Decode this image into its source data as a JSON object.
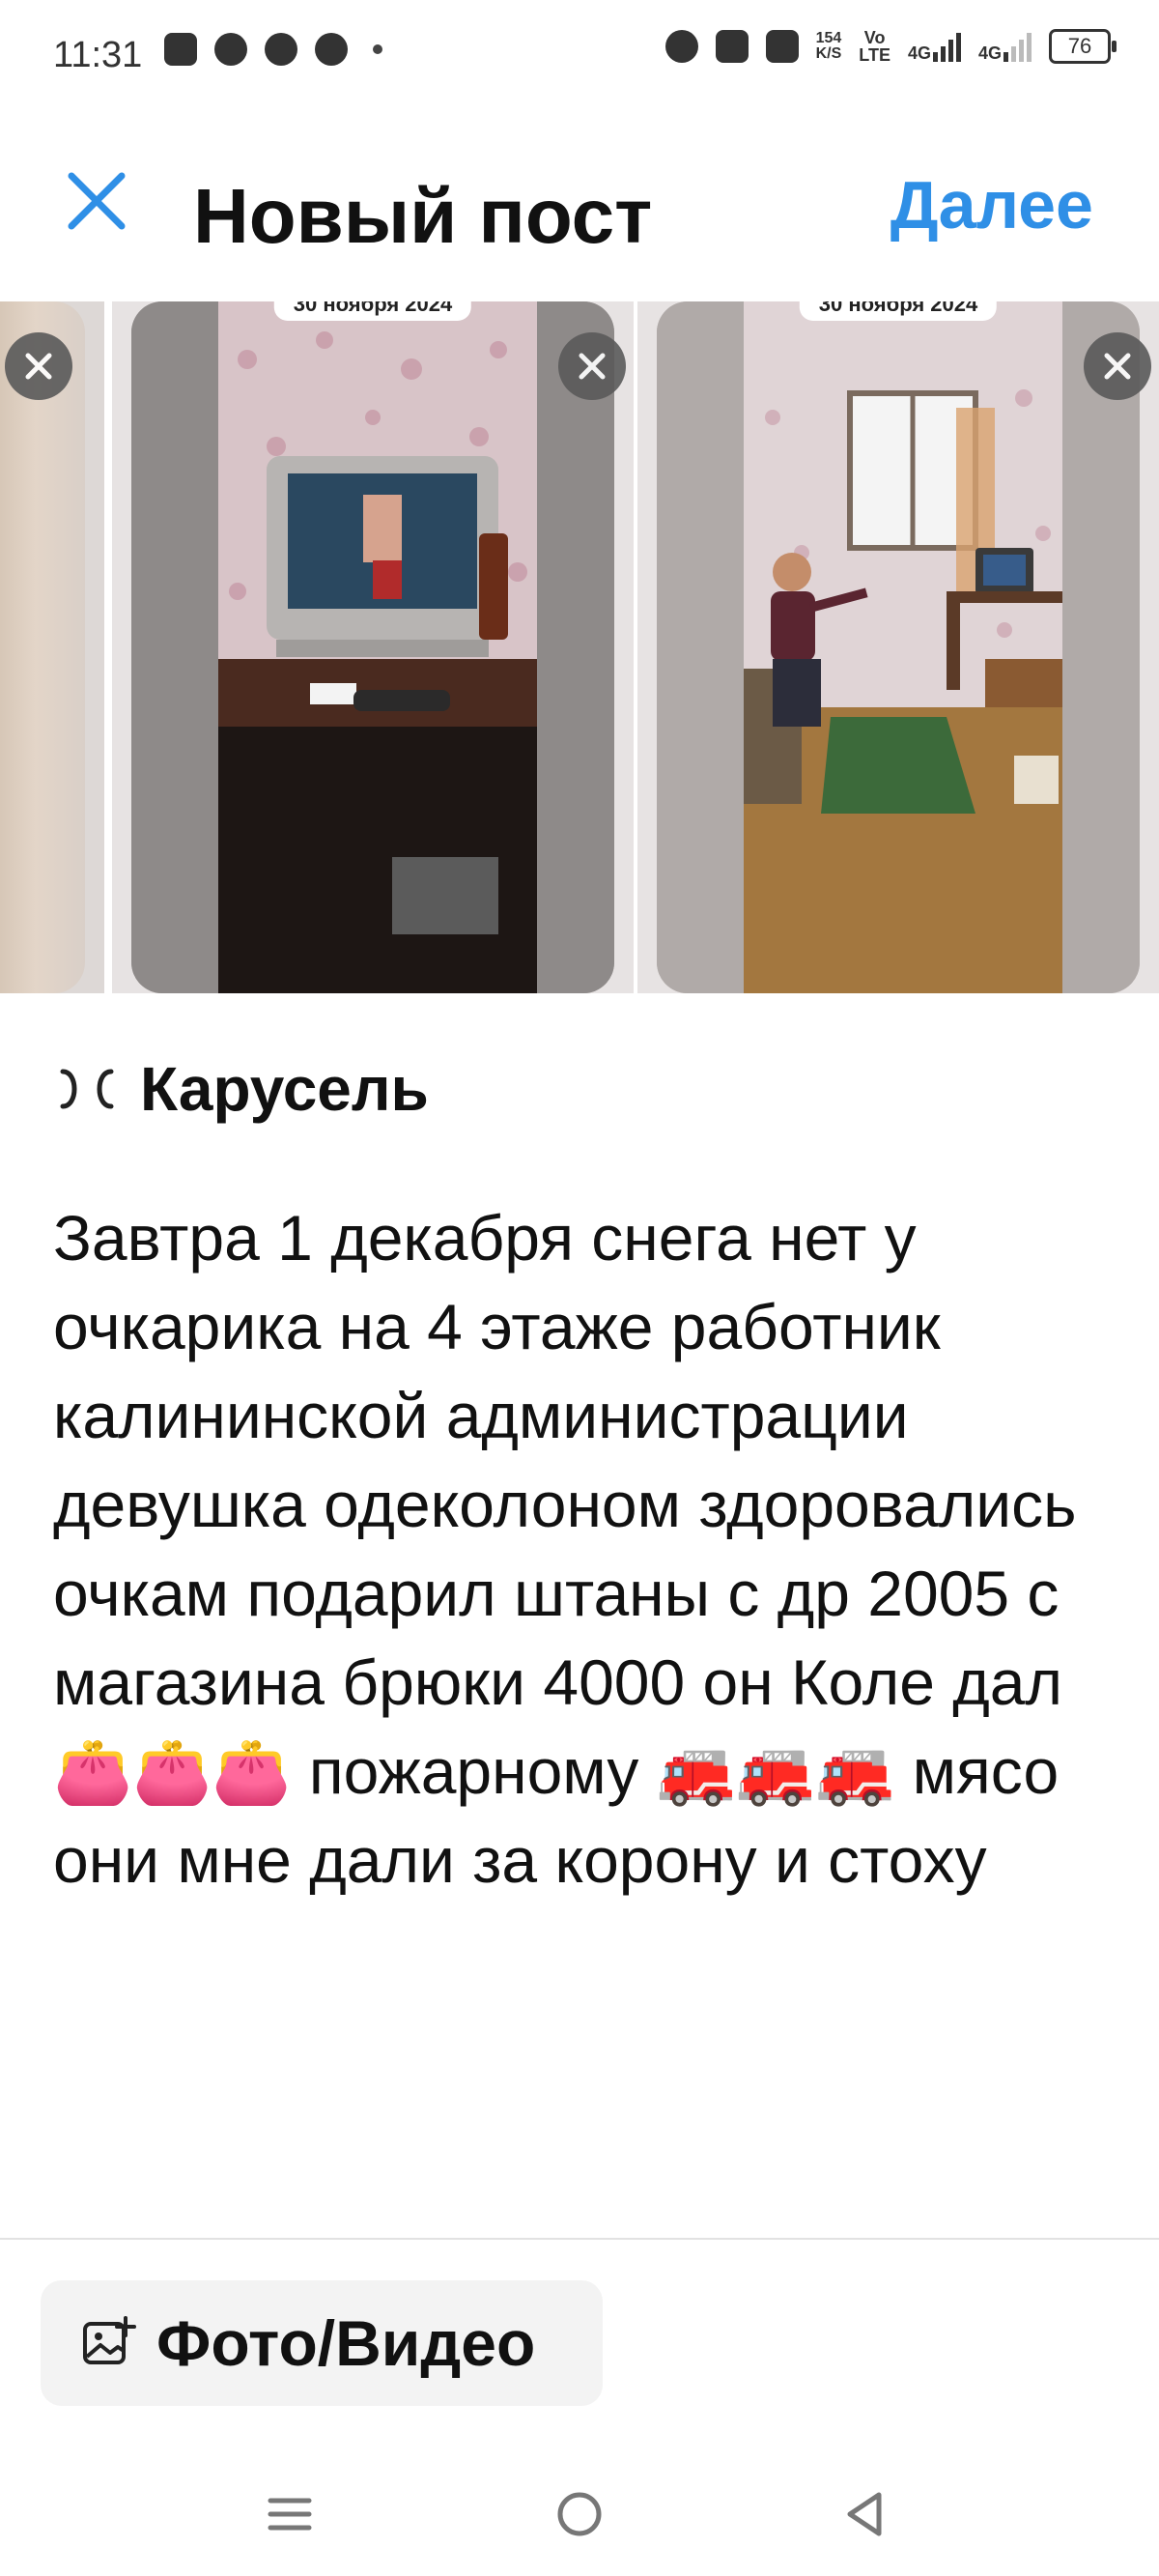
{
  "status_bar": {
    "time": "11:31",
    "net_rate_value": "154",
    "net_rate_unit": "K/S",
    "volte_top": "Vo",
    "volte_bottom": "LTE",
    "signal1_label": "4G",
    "signal2_label": "4G",
    "battery_level": "76"
  },
  "header": {
    "title": "Новый пост",
    "next_label": "Далее"
  },
  "carousel": {
    "slides": [
      {
        "date": "30 ноября 2024"
      },
      {
        "date": "30 ноября 2024"
      }
    ]
  },
  "carousel_toggle": {
    "label": "Карусель"
  },
  "post": {
    "text": "Завтра 1 декабря снега нет у очкарика на 4 этаже работник калининской администрации девушка одеколоном здоровались очкам подарил штаны с др 2005 с магазина брюки 4000 он Коле дал 👛👛👛 пожарному 🚒🚒🚒 мясо они мне дали за корону и стоху"
  },
  "attach": {
    "label": "Фото/Видео"
  },
  "colors": {
    "accent": "#2f8fe6",
    "text": "#111111",
    "button_bg": "#f3f3f3"
  }
}
